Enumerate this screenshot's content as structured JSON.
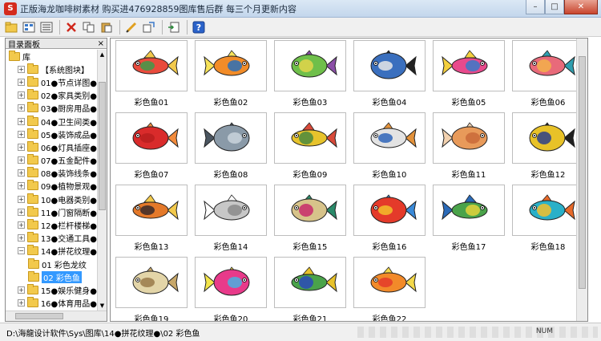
{
  "window": {
    "title": "正版海龙咖啡树素材 购买进476928859图库售后群 每三个月更新内容",
    "icon_text": "S",
    "buttons": {
      "minimize": "–",
      "maximize": "□",
      "close": "✕"
    }
  },
  "toolbar": {
    "items": [
      "open-icon",
      "view-icon",
      "list-icon",
      "delete-icon",
      "copy-icon",
      "paste-icon",
      "edit-icon",
      "import-icon",
      "insert-icon",
      "help-icon"
    ]
  },
  "left_panel": {
    "title": "目录面板",
    "close": "×",
    "tree": [
      {
        "label": "库",
        "expander": "",
        "level": 0
      },
      {
        "label": "【系统图块】",
        "expander": "+",
        "level": 1
      },
      {
        "label": "01●节点详图●",
        "expander": "+",
        "level": 1
      },
      {
        "label": "02●家具类别●",
        "expander": "+",
        "level": 1
      },
      {
        "label": "03●厨房用品●",
        "expander": "+",
        "level": 1
      },
      {
        "label": "04●卫生间类●",
        "expander": "+",
        "level": 1
      },
      {
        "label": "05●装饰成品●",
        "expander": "+",
        "level": 1
      },
      {
        "label": "06●灯具插座●",
        "expander": "+",
        "level": 1
      },
      {
        "label": "07●五金配件●",
        "expander": "+",
        "level": 1
      },
      {
        "label": "08●装饰线条●",
        "expander": "+",
        "level": 1
      },
      {
        "label": "09●植物景观●",
        "expander": "+",
        "level": 1
      },
      {
        "label": "10●电器类别●",
        "expander": "+",
        "level": 1
      },
      {
        "label": "11●门窗隔断●",
        "expander": "+",
        "level": 1
      },
      {
        "label": "12●栏杆楼梯●",
        "expander": "+",
        "level": 1
      },
      {
        "label": "13●交通工具●",
        "expander": "+",
        "level": 1
      },
      {
        "label": "14●拼花纹理●",
        "expander": "−",
        "level": 1
      },
      {
        "label": "01 彩色龙纹",
        "expander": "",
        "level": 2
      },
      {
        "label": "02 彩色鱼",
        "expander": "",
        "level": 2,
        "selected": true
      },
      {
        "label": "15●娱乐健身●",
        "expander": "+",
        "level": 1
      },
      {
        "label": "16●体育用品●",
        "expander": "+",
        "level": 1
      }
    ]
  },
  "grid": {
    "items": [
      {
        "label": "彩色鱼01",
        "colors": [
          "#e94b3c",
          "#3f9a4a",
          "#f2c94c"
        ]
      },
      {
        "label": "彩色鱼02",
        "colors": [
          "#f28c28",
          "#2a6fb8",
          "#f7e35a"
        ]
      },
      {
        "label": "彩色鱼03",
        "colors": [
          "#6fbf4a",
          "#e3d54a",
          "#8c4fa8"
        ]
      },
      {
        "label": "彩色鱼04",
        "colors": [
          "#3a6fbe",
          "#e7e7e7",
          "#222222"
        ]
      },
      {
        "label": "彩色鱼05",
        "colors": [
          "#e84a8c",
          "#3a79c9",
          "#f4d03f"
        ]
      },
      {
        "label": "彩色鱼06",
        "colors": [
          "#e86a7a",
          "#f3b04a",
          "#2f9fb0"
        ]
      },
      {
        "label": "彩色鱼07",
        "colors": [
          "#d92b2b",
          "#b81f1f",
          "#f28b3c"
        ]
      },
      {
        "label": "彩色鱼08",
        "colors": [
          "#8a9aa8",
          "#c9d3dc",
          "#4a5560"
        ]
      },
      {
        "label": "彩色鱼09",
        "colors": [
          "#e7c32c",
          "#4a8a3e",
          "#d94a3a"
        ]
      },
      {
        "label": "彩色鱼10",
        "colors": [
          "#e3e3e3",
          "#2e64b8",
          "#e3923b"
        ]
      },
      {
        "label": "彩色鱼11",
        "colors": [
          "#e89a5a",
          "#c96a3a",
          "#f3d2b0"
        ]
      },
      {
        "label": "彩色鱼12",
        "colors": [
          "#e8c228",
          "#2b3f8a",
          "#1f1f1f"
        ]
      },
      {
        "label": "彩色鱼13",
        "colors": [
          "#e4792a",
          "#3a2a2a",
          "#f2c94c"
        ]
      },
      {
        "label": "彩色鱼14",
        "colors": [
          "#c7c7c7",
          "#8a8a8a",
          "#ffffff"
        ]
      },
      {
        "label": "彩色鱼15",
        "colors": [
          "#d7c38a",
          "#c82a6a",
          "#2a8a6a"
        ]
      },
      {
        "label": "彩色鱼16",
        "colors": [
          "#e43a2a",
          "#f3c02a",
          "#3a8ad9"
        ]
      },
      {
        "label": "彩色鱼17",
        "colors": [
          "#4aa34a",
          "#e3d43a",
          "#2a6ab8"
        ]
      },
      {
        "label": "彩色鱼18",
        "colors": [
          "#2ab0c8",
          "#f3c02a",
          "#e86a2a"
        ]
      },
      {
        "label": "彩色鱼19",
        "colors": [
          "#e3d5a8",
          "#9a7a4a",
          "#c8a86a"
        ]
      },
      {
        "label": "彩色鱼20",
        "colors": [
          "#e83a8a",
          "#4ab0e0",
          "#f3e54a"
        ]
      },
      {
        "label": "彩色鱼21",
        "colors": [
          "#4aa34a",
          "#2a4ab8",
          "#e8c22a"
        ]
      },
      {
        "label": "彩色鱼22",
        "colors": [
          "#f28a2a",
          "#e43a2a",
          "#f3d84a"
        ]
      }
    ]
  },
  "status_bar": {
    "path": "D:\\海龍设计软件\\Sys\\图库\\14●拼花纹理●\\02 彩色鱼",
    "num": "NUM"
  }
}
